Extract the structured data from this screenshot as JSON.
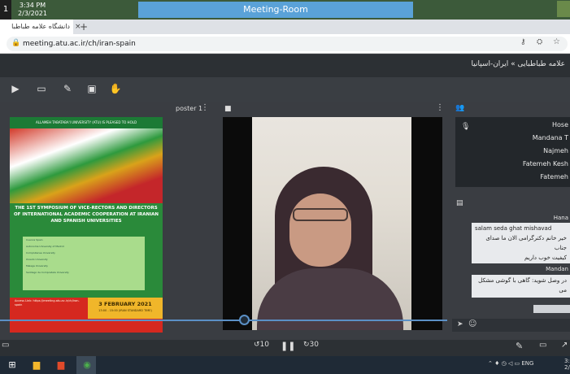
{
  "window": {
    "left_number": "1",
    "clock_time": "3:34 PM",
    "clock_date": "2/3/2021",
    "title": "Meeting-Room"
  },
  "browser": {
    "tab_title": "دانشگاه علامه طباطبا",
    "tab_close": "×",
    "new_tab": "+",
    "url": "meeting.atu.ac.ir/ch/iran-spain"
  },
  "app": {
    "breadcrumb": "علامه طباطبایی » ایران-اسپانیا"
  },
  "panels": {
    "poster_label": "poster 1",
    "menu_glyph": "⋮"
  },
  "poster": {
    "header": "ALLAMEH TABATABA'I UNIVERSITY (ATU) IS PLEASED TO HOLD",
    "title": "THE 1ST SYMPOSIUM OF VICE-RECTORS AND DIRECTORS OF INTERNATIONAL ACADEMIC COOPERATION AT IRANIAN AND SPANISH UNIVERSITIES",
    "table_lines": [
      "Cuenca Spain",
      "Autonoma University of Madrid",
      "Complutense University",
      "Oviedo University",
      "Malaga University",
      "Santiago de Compostela University"
    ],
    "link_text": "Access Link: https://meeting.atu.ac.ir/ch/iran-spain",
    "date": "3 FEBRUARY 2021",
    "time": "13:00 - 15:00 (IRAN STANDARD TIME)"
  },
  "participants": [
    {
      "name": "Hose"
    },
    {
      "name": "Mandana T"
    },
    {
      "name": "Najmeh"
    },
    {
      "name": "Fatemeh Kesh"
    },
    {
      "name": "Fatemeh"
    }
  ],
  "chat": {
    "messages": [
      {
        "author": "Hana",
        "lines": [
          "salam seda ghat mishavad",
          "خیر خانم دکترگرامی الان ما صدای جناب",
          "کیفیت خوب داریم"
        ]
      },
      {
        "author": "Mandan",
        "lines": [
          "در وصل شوید: گاهی با گوشی مشکل می"
        ]
      }
    ]
  },
  "player": {
    "rewind_label": "10",
    "forward_label": "30",
    "progress_fraction": 0.545
  },
  "taskbar": {
    "lang": "ENG",
    "tray_time": "3:",
    "tray_date": "2/"
  },
  "colors": {
    "accent": "#5b90c6",
    "title_bar": "#5aa2d8"
  }
}
